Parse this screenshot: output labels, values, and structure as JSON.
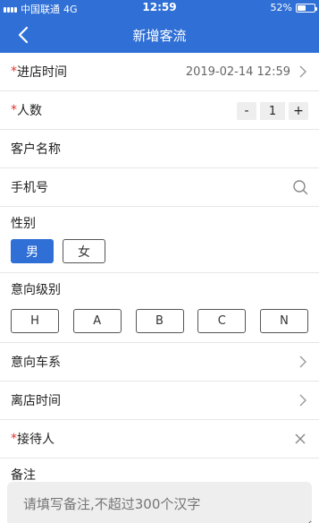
{
  "status_bar": {
    "carrier": "中国联通",
    "network": "4G",
    "time": "12:59",
    "battery": "52%",
    "battery_level": 0.52
  },
  "navbar": {
    "title": "新增客流",
    "back_icon": "chevron-left-icon"
  },
  "form": {
    "arrival_time": {
      "required_mark": "*",
      "label": "进店时间",
      "value": "2019-02-14 12:59"
    },
    "people_count": {
      "required_mark": "*",
      "label": "人数",
      "value": "1",
      "minus": "-",
      "plus": "+"
    },
    "customer_name": {
      "label": "客户名称"
    },
    "phone": {
      "label": "手机号"
    },
    "gender": {
      "label": "性别",
      "options": [
        "男",
        "女"
      ],
      "selected": "男"
    },
    "intent_level": {
      "label": "意向级别",
      "options": [
        "H",
        "A",
        "B",
        "C",
        "N"
      ]
    },
    "intent_series": {
      "label": "意向车系"
    },
    "leave_time": {
      "label": "离店时间"
    },
    "receptionist": {
      "required_mark": "*",
      "label": "接待人"
    },
    "remark": {
      "label": "备注",
      "placeholder": "请填写备注,不超过300个汉字"
    }
  },
  "colors": {
    "primary": "#2f6fd6",
    "required": "#e0342c"
  }
}
